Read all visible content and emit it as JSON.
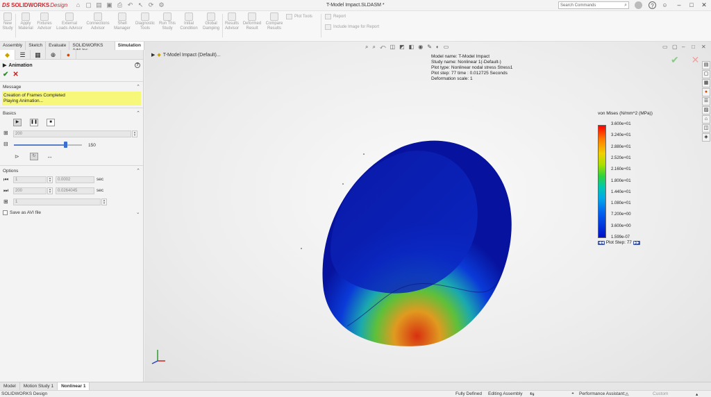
{
  "app": {
    "logo_ds": "DS",
    "logo_brand": "SOLIDWORKS",
    "logo_suffix": "Design",
    "document_title": "T-Model Impact.SLDASM *"
  },
  "search": {
    "placeholder": "Search Commands"
  },
  "ribbon": {
    "buttons": [
      {
        "label": "New Study"
      },
      {
        "label": "Apply Material"
      },
      {
        "label": "Fixtures Advisor"
      },
      {
        "label": "External Loads Advisor"
      },
      {
        "label": "Connections Advisor"
      },
      {
        "label": "Shell Manager"
      },
      {
        "label": "Diagnostic Tools"
      },
      {
        "label": "Run This Study"
      },
      {
        "label": "Initial Condition"
      },
      {
        "label": "Global Damping"
      },
      {
        "label": "Results Advisor"
      },
      {
        "label": "Deformed Result"
      },
      {
        "label": "Compare Results"
      }
    ],
    "plot_tools": "Plot Tools",
    "report": "Report",
    "include_image": "Include Image for Report"
  },
  "cm_tabs": [
    "Assembly",
    "Sketch",
    "Evaluate",
    "SOLIDWORKS Add-Ins",
    "Simulation"
  ],
  "panel": {
    "title": "Animation",
    "message_header": "Message",
    "message_lines": [
      "Creation of Frames Completed",
      "Playing Animation..."
    ],
    "basics_header": "Basics",
    "frames_value": "200",
    "speed_value": "150",
    "speed_level": 0.75,
    "options_header": "Options",
    "start_frame": "1",
    "start_time": "0.0002",
    "end_frame": "200",
    "end_time": "0.0264045",
    "sec_label": "sec",
    "step_value": "1",
    "save_avi": "Save as AVI file"
  },
  "viewport": {
    "tree_flyout": "T-Model Impact (Default)...",
    "info_lines": [
      "Model name: T-Model Impact",
      "Study name: Nonlinear 1(-Default-)",
      "Plot type: Nonlinear nodal stress Stress1",
      "Plot step: 77   time : 0.012725 Seconds",
      "Deformation scale: 1"
    ],
    "legend_title": "von Mises (N/mm^2 (MPa))",
    "legend_ticks": [
      "3.600e+01",
      "3.240e+01",
      "2.880e+01",
      "2.520e+01",
      "2.160e+01",
      "1.800e+01",
      "1.440e+01",
      "1.080e+01",
      "7.200e+00",
      "3.600e+00",
      "1.599e-07"
    ],
    "plot_step_label": "Plot Step: 77"
  },
  "bottom_tabs": [
    "Model",
    "Motion Study 1",
    "Nonlinear 1"
  ],
  "status": {
    "app_name": "SOLIDWORKS Design",
    "defined": "Fully Defined",
    "mode": "Editing Assembly",
    "assistant": "Performance Assistant:",
    "units": "Custom"
  },
  "colors": {
    "brand": "#d3232a",
    "ok": "#2e8b2e",
    "cancel": "#cc1a1a",
    "message_bg": "#f7f77a"
  }
}
